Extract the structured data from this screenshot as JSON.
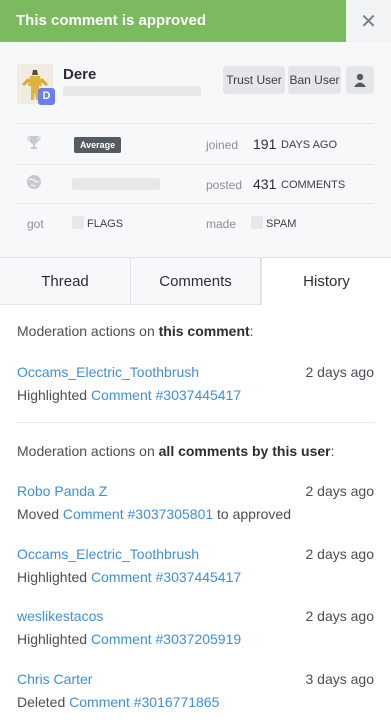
{
  "banner": {
    "text": "This comment is approved"
  },
  "profile": {
    "username": "Dere",
    "avatar_badge": "D",
    "actions": {
      "trust": "Trust User",
      "ban": "Ban User"
    },
    "stats": {
      "level": "Average",
      "joined_label": "joined",
      "joined_value": "191",
      "joined_unit": "DAYS AGO",
      "posted_label": "posted",
      "posted_value": "431",
      "posted_unit": "COMMENTS",
      "got_label": "got",
      "flags_unit": "FLAGS",
      "made_label": "made",
      "spam_unit": "SPAM"
    }
  },
  "tabs": [
    "Thread",
    "Comments",
    "History"
  ],
  "history": {
    "comment_heading_prefix": "Moderation actions on ",
    "comment_heading_bold": "this comment",
    "comment_heading_suffix": ":",
    "comment_entries": [
      {
        "user": "Occams_Electric_Toothbrush",
        "time": "2 days ago",
        "verb": "Highlighted ",
        "link": "Comment #3037445417",
        "suffix": ""
      }
    ],
    "user_heading_prefix": "Moderation actions on ",
    "user_heading_bold": "all comments by this user",
    "user_heading_suffix": ":",
    "user_entries": [
      {
        "user": "Robo Panda Z",
        "time": "2 days ago",
        "verb": "Moved ",
        "link": "Comment #3037305801",
        "suffix": " to approved"
      },
      {
        "user": "Occams_Electric_Toothbrush",
        "time": "2 days ago",
        "verb": "Highlighted ",
        "link": "Comment #3037445417",
        "suffix": ""
      },
      {
        "user": "weslikestacos",
        "time": "2 days ago",
        "verb": "Highlighted ",
        "link": "Comment #3037205919",
        "suffix": ""
      },
      {
        "user": "Chris Carter",
        "time": "3 days ago",
        "verb": "Deleted ",
        "link": "Comment #3016771865",
        "suffix": ""
      }
    ]
  },
  "colors": {
    "banner_green": "#7cba60",
    "link_blue": "#3f8fd8",
    "badge_purple": "#6b7ff0"
  }
}
